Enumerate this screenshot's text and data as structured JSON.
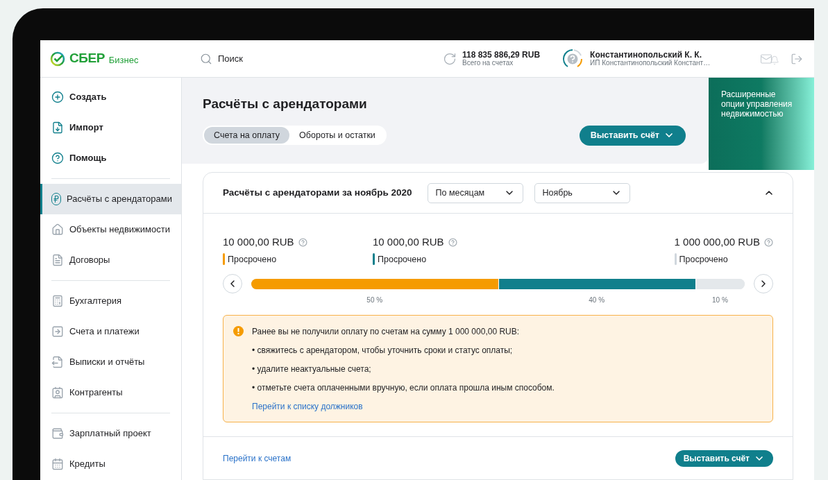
{
  "header": {
    "logo": {
      "brand": "СБЕР",
      "product": "Бизнес"
    },
    "search": {
      "placeholder": "Поиск"
    },
    "balance": {
      "amount": "118 835 886,29 RUB",
      "caption": "Всего на счетах"
    },
    "user": {
      "name": "Константинопольский К. К.",
      "company": "ИП Константинопольский Констант…"
    }
  },
  "sidebar": {
    "groups": [
      {
        "kind": "actions",
        "items": [
          {
            "label": "Создать",
            "selected": false
          },
          {
            "label": "Импорт",
            "selected": false
          },
          {
            "label": "Помощь",
            "selected": false
          }
        ]
      },
      {
        "kind": "nav",
        "items": [
          {
            "label": "Расчёты с арендаторами",
            "selected": true
          },
          {
            "label": "Объекты недвижимости",
            "selected": false
          },
          {
            "label": "Договоры",
            "selected": false
          }
        ]
      },
      {
        "kind": "nav",
        "items": [
          {
            "label": "Бухгалтерия",
            "selected": false
          },
          {
            "label": "Счета и платежи",
            "selected": false
          },
          {
            "label": "Выписки и отчёты",
            "selected": false
          },
          {
            "label": "Контрагенты",
            "selected": false
          }
        ]
      },
      {
        "kind": "nav",
        "items": [
          {
            "label": "Зарплатный проект",
            "selected": false
          },
          {
            "label": "Кредиты",
            "selected": false
          }
        ]
      }
    ]
  },
  "page": {
    "title": "Расчёты с арендаторами",
    "tabs": [
      {
        "label": "Счета на оплату",
        "selected": true
      },
      {
        "label": "Обороты и остатки",
        "selected": false
      }
    ],
    "action_button": "Выставить счёт",
    "promo": "Расширенные опции управления недвижимостью"
  },
  "card": {
    "title": "Расчёты с арендаторами за ноябрь 2020",
    "expanded": true,
    "selects": [
      {
        "value": "По месяцам"
      },
      {
        "value": "Ноябрь"
      }
    ],
    "summary": [
      {
        "amount": "10 000,00 RUB",
        "label": "Просрочено",
        "color": "#f59b00"
      },
      {
        "amount": "10 000,00 RUB",
        "label": "Просрочено",
        "color": "#107f8c"
      },
      {
        "amount": "1 000 000,00 RUB",
        "label": "Просрочено",
        "color": "#d0d7dd"
      }
    ],
    "segments": [
      {
        "label": "50 %",
        "color": "#f59b00"
      },
      {
        "label": "40 %",
        "color": "#107f8c"
      },
      {
        "label": "10 %",
        "color": "#e4e8eb"
      }
    ],
    "alert": {
      "text": "Ранее вы не получили оплату по счетам на сумму 1 000 000,00 RUB:",
      "bullets": [
        "• свяжитесь с арендатором, чтобы уточнить сроки и статус оплаты;",
        "• удалите неактуальные счета;",
        "• отметьте счета оплаченными вручную, если оплата прошла иным способом."
      ],
      "link": "Перейти к списку должников"
    },
    "footer": {
      "link": "Перейти к счетам",
      "button": "Выставить счёт"
    }
  }
}
